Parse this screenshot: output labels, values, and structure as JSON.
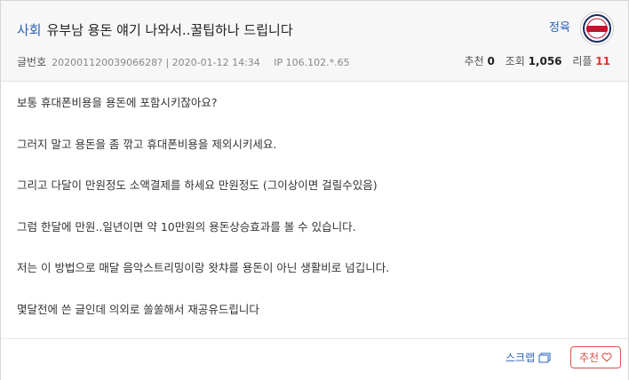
{
  "post": {
    "category": "사회",
    "title": "유부남 용돈 얘기 나와서..꿀팁하나 드립니다",
    "author": "정육",
    "logo_text": "Giants",
    "meta_label": "글번호",
    "post_id": "20200112003906628?",
    "date": "2020-01-12 14:34",
    "ip": "IP 106.102.*.65"
  },
  "stats": {
    "recommend_label": "추천",
    "recommend_value": "0",
    "views_label": "조회",
    "views_value": "1,056",
    "replies_label": "리플",
    "replies_value": "11"
  },
  "body_lines": [
    "보통 휴대폰비용을 용돈에 포함시키잖아요?",
    "그러지 말고 용돈을 좀 깎고 휴대폰비용을 제외시키세요.",
    "그리고 다달이 만원정도 소액결제를 하세요 만원정도 (그이상이면 걸릴수있음)",
    "그럼 한달에 만원..일년이면 약 10만원의 용돈상승효과를 볼 수 있습니다.",
    "저는 이 방법으로 매달 음악스트리밍이랑 왓챠를 용돈이 아닌 생활비로 넘깁니다.",
    "몇달전에 쓴 글인데 의외로 쏠쏠해서 재공유드립니다"
  ],
  "footer": {
    "scrap_label": "스크랩",
    "recommend_button": "추천"
  },
  "colors": {
    "accent_blue": "#2d63b8",
    "reply_red": "#d43b2b",
    "recommend_border": "#d9534f"
  }
}
